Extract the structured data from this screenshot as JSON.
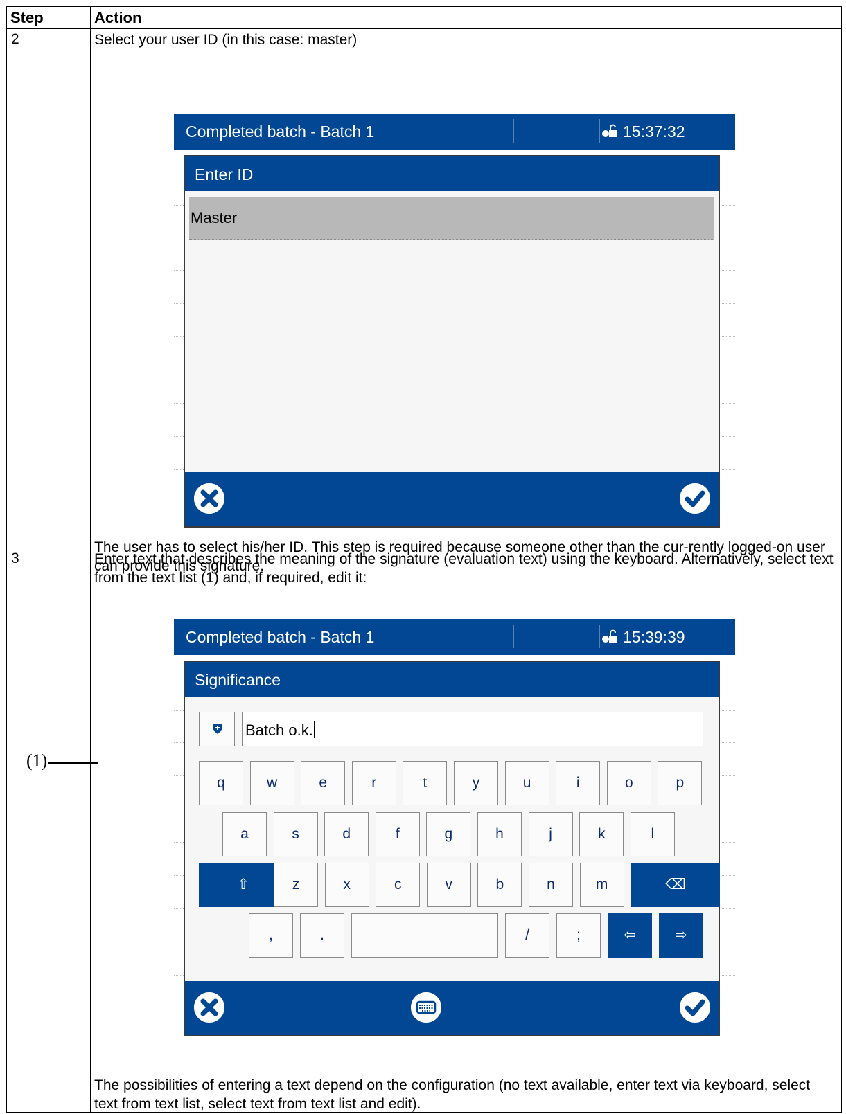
{
  "table": {
    "header_step": "Step",
    "header_action": "Action",
    "rows": [
      {
        "step": "2",
        "instruction": "Select your user ID (in this case: master)",
        "note": "The user has to select his/her ID. This step is required because someone other than the cur-rently logged-on user can provide this signature."
      },
      {
        "step": "3",
        "instruction": "Enter text that describes the meaning of the signature (evaluation text) using the keyboard. Alternatively, select text from the text list (1) and, if required, edit it:",
        "note": "The possibilities of entering a text depend on the configuration (no text available, enter text via keyboard, select text from text list, select text from text list and edit)."
      }
    ]
  },
  "screen1": {
    "title": "Completed batch - Batch 1",
    "time": "15:37:32",
    "dialog_title": "Enter ID",
    "list_items": [
      "Master"
    ]
  },
  "screen2": {
    "title": "Completed batch - Batch 1",
    "time": "15:39:39",
    "dialog_title": "Significance",
    "input_value": "Batch o.k.",
    "keyboard": {
      "row1": [
        "q",
        "w",
        "e",
        "r",
        "t",
        "y",
        "u",
        "i",
        "o",
        "p"
      ],
      "row2": [
        "a",
        "s",
        "d",
        "f",
        "g",
        "h",
        "j",
        "k",
        "l"
      ],
      "row3": [
        "z",
        "x",
        "c",
        "v",
        "b",
        "n",
        "m"
      ],
      "shift": "⇧",
      "backspace": "⌫",
      "row4": [
        ",",
        ".",
        "",
        "/",
        ";"
      ],
      "left": "⇦",
      "right": "⇨"
    }
  },
  "callout": "(1)",
  "colors": {
    "primary": "#014793",
    "selected_row": "#b8b8b8"
  }
}
